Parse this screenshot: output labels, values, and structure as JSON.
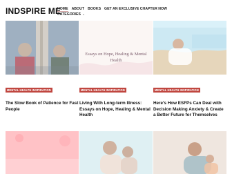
{
  "header": {
    "logo": "INDSPIRE ME",
    "nav": [
      "HOME",
      "ABOUT",
      "BOOKS",
      "GET AN EXCLUSIVE CHAPTER NOW"
    ],
    "categories_label": "CATEGORIES"
  },
  "cards": [
    {
      "category": "MENTAL HEALTH INSPIRATION",
      "title": "The Slow Book of Patience for Fast People"
    },
    {
      "category": "MENTAL HEALTH INSPIRATION",
      "title": "Living With Long-term Illness: Essays on Hope, Healing & Mental Health",
      "thumb_title": "Essays on Hope, Healing & Mental Health"
    },
    {
      "category": "MENTAL HEALTH INSPIRATION",
      "title": "Here's How ESFPs Can Deal with Decision Making Anxiety & Create a Better Future for Themselves"
    }
  ],
  "icons": {
    "chevron": "chevron-down-icon"
  }
}
